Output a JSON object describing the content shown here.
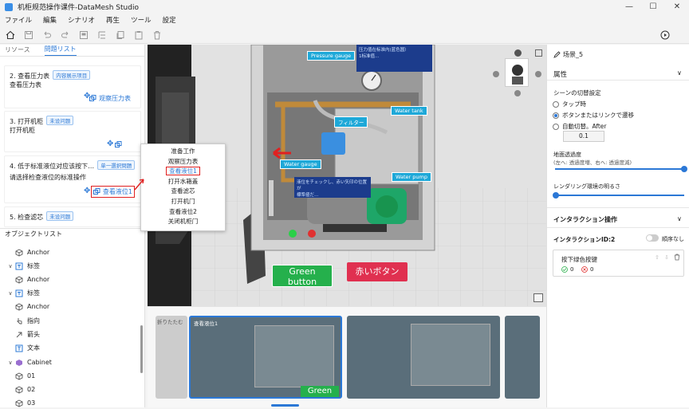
{
  "window": {
    "title": "机柜规范操作课件-DataMesh Studio",
    "controls": [
      "—",
      "☐",
      "✕"
    ]
  },
  "menu": [
    "ファイル",
    "編集",
    "シナリオ",
    "再生",
    "ツール",
    "設定"
  ],
  "left_tabs": [
    "リソース",
    "問題リスト"
  ],
  "steps": [
    {
      "title": "2. 查看压力表",
      "badge": "内容展示项目",
      "sub": "查看压力表",
      "action": "观察压力表"
    },
    {
      "title": "3. 打开机柜",
      "badge": "未设问题",
      "sub": "打开机柜",
      "action": ""
    },
    {
      "title": "4. 低于标准液位对应该按下…",
      "badge": "单一選択問題",
      "sub": "请选择检查液位的标准操作",
      "action": "查看液位1"
    },
    {
      "title": "5. 检查滤芯",
      "badge": "未设问题",
      "sub": "",
      "action": ""
    }
  ],
  "object_list": {
    "header": "オブジェクトリスト",
    "rows": [
      {
        "label": "Anchor",
        "indent": 2,
        "icon": "cube"
      },
      {
        "label": "标签",
        "indent": 1,
        "icon": "label"
      },
      {
        "label": "Anchor",
        "indent": 2,
        "icon": "cube"
      },
      {
        "label": "标签",
        "indent": 1,
        "icon": "label"
      },
      {
        "label": "Anchor",
        "indent": 2,
        "icon": "cube"
      },
      {
        "label": "指向",
        "indent": 1,
        "icon": "pointer"
      },
      {
        "label": "箭头",
        "indent": 1,
        "icon": "arrow"
      },
      {
        "label": "文本",
        "indent": 1,
        "icon": "text"
      },
      {
        "label": "Cabinet",
        "indent": 0,
        "icon": "model"
      },
      {
        "label": "01",
        "indent": 1,
        "icon": "cube"
      },
      {
        "label": "02",
        "indent": 1,
        "icon": "cube"
      },
      {
        "label": "03",
        "indent": 1,
        "icon": "cube"
      }
    ]
  },
  "context_menu": [
    "准备工作",
    "观察压力表",
    "查看液位1",
    "打开水箱盖",
    "查看滤芯",
    "打开机门",
    "查看液位2",
    "关闭机柜门"
  ],
  "context_menu_selected": "查看液位1",
  "viewport": {
    "labels": {
      "pressure_gauge": "Pressure gauge",
      "water_tank": "Water tank",
      "filter": "フィルター",
      "water_gauge": "Water gauge",
      "water_pump": "Water pump"
    },
    "green_button": "Green\nbutton",
    "red_button": "赤いボタン",
    "info_box_top": "压力值在标准内(蓝色圆）\n1标准值…",
    "info_box_mid": "液位をチェックし、赤い矢印の位置が\n標準値だ…"
  },
  "timeline": {
    "collapse": "折りたたむ",
    "current": "查看液位1",
    "thumb_text": "Green"
  },
  "right_panel": {
    "scene": "场景_5",
    "attributes": "属性",
    "switch_setting": "シーンの切替設定",
    "options": [
      "タップ時",
      "ボタンまたはリンクで遷移",
      "自動切替。After"
    ],
    "selected_option": 1,
    "auto_value": "0.1",
    "transparency": "地面透過度",
    "transparency_hint": "(左へ: 透過度増、右へ: 透過度減)",
    "transparency_level": 1.0,
    "rendering": "レンダリング環境の明るさ",
    "rendering_level": 0.0,
    "interaction": "インタラクション操作",
    "interaction_id": "インタラクションID:2",
    "order_toggle": "順序なし",
    "action_name": "按下绿色按键",
    "ok_count": "0",
    "ng_count": "0"
  },
  "colors": {
    "accent": "#2b78d6",
    "label_bg": "#1ea8d8",
    "red_outline": "#e02020"
  }
}
